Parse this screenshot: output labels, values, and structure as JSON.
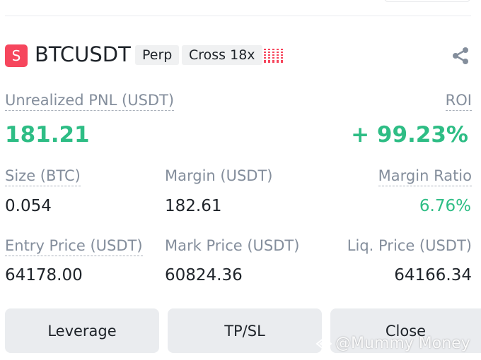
{
  "header": {
    "side": "S",
    "symbol": "BTCUSDT",
    "tags": [
      "Perp",
      "Cross 18x"
    ],
    "share_icon": "share-icon"
  },
  "pnl": {
    "label": "Unrealized PNL (USDT)",
    "value": "181.21",
    "roi_label": "ROI",
    "roi_value": "+ 99.23%"
  },
  "row1": {
    "size_label": "Size (BTC)",
    "size_value": "0.054",
    "margin_label": "Margin (USDT)",
    "margin_value": "182.61",
    "ratio_label": "Margin Ratio",
    "ratio_value": "6.76%"
  },
  "row2": {
    "entry_label": "Entry Price (USDT)",
    "entry_value": "64178.00",
    "mark_label": "Mark Price (USDT)",
    "mark_value": "60824.36",
    "liq_label": "Liq. Price (USDT)",
    "liq_value": "64166.34"
  },
  "buttons": {
    "leverage": "Leverage",
    "tpsl": "TP/SL",
    "close": "Close"
  },
  "watermark": "@Mummy Money",
  "colors": {
    "green": "#2ebd85",
    "red": "#f6465d",
    "muted": "#848e9c",
    "button_bg": "#eaecef"
  }
}
